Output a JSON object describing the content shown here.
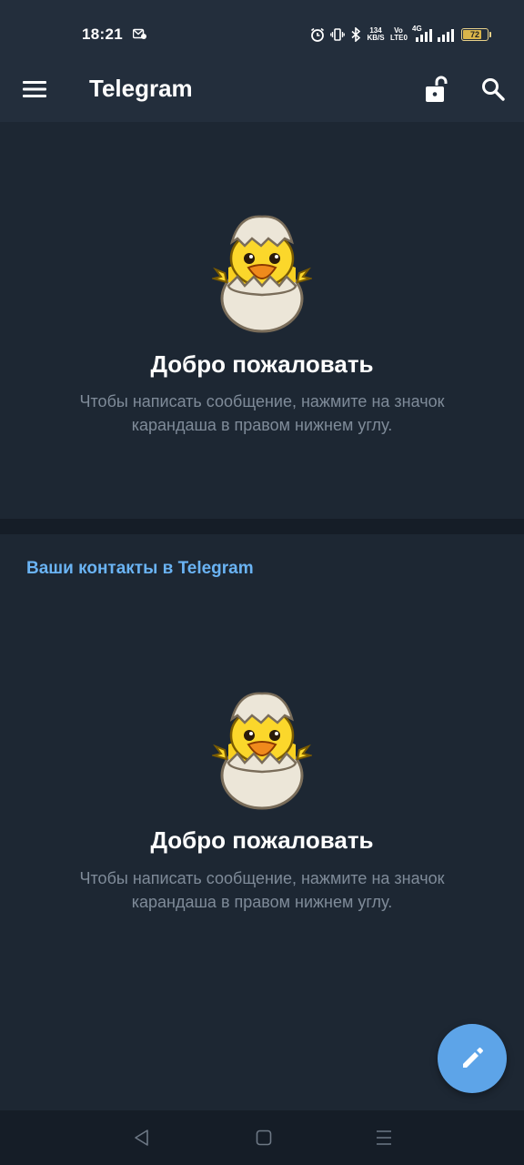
{
  "status_bar": {
    "time": "18:21",
    "net_speed_value": "134",
    "net_speed_unit": "KB/S",
    "volte_top": "Vo",
    "volte_bottom": "LTE0",
    "network_type": "4G",
    "battery_level": "72",
    "battery_color": "#d9b54a"
  },
  "app_bar": {
    "title": "Telegram",
    "menu_icon": "hamburger-menu-icon",
    "lock_icon": "unlocked-padlock-icon",
    "search_icon": "search-icon"
  },
  "welcome": {
    "title": "Добро пожаловать",
    "text": "Чтобы написать сообщение, нажмите на значок карандаша в правом нижнем углу."
  },
  "contacts": {
    "header": "Ваши контакты в Telegram",
    "welcome_title": "Добро пожаловать",
    "welcome_text": "Чтобы написать сообщение, нажмите на значок карандаша в правом нижнем углу."
  },
  "fab": {
    "icon": "pencil-icon"
  },
  "nav_bar": {
    "back_icon": "back-triangle-icon",
    "home_icon": "home-square-icon",
    "recents_icon": "recents-lines-icon"
  },
  "colors": {
    "background": "#1d2733",
    "app_bar": "#232e3c",
    "accent": "#6ab3f3",
    "fab": "#5da4e8",
    "secondary_text": "#7f8b99"
  }
}
